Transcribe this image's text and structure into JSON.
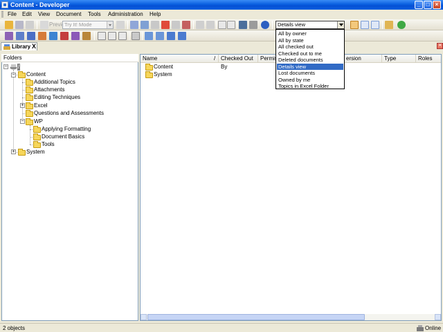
{
  "window": {
    "title": "Content - Developer"
  },
  "menu": [
    "File",
    "Edit",
    "View",
    "Document",
    "Tools",
    "Administration",
    "Help"
  ],
  "toolbar": {
    "preview_label": "Preview",
    "mode_value": "Try It! Mode"
  },
  "view_selector": {
    "value": "Details view",
    "options": [
      "All by owner",
      "All by state",
      "All checked out",
      "Checked out to me",
      "Deleted documents",
      "Details view",
      "Lost documents",
      "Owned by me",
      "Topics in Excel Folder"
    ],
    "selected_index": 5
  },
  "library_tab": {
    "label": "Library",
    "close": "X"
  },
  "folders": {
    "header": "Folders",
    "root": "/",
    "items": [
      "Content",
      "Additional Topics",
      "Attachments",
      "Editing Techniques",
      "Excel",
      "Questions and Assessments",
      "WP",
      "Applying Formatting",
      "Document Basics",
      "Tools",
      "System"
    ]
  },
  "list": {
    "columns": [
      "Name",
      "/",
      "Checked Out By",
      "Permissi",
      "ersion",
      "Type",
      "Roles"
    ],
    "rows": [
      "Content",
      "System"
    ]
  },
  "status": {
    "count": "2 objects",
    "connection": "Online"
  },
  "colors": {
    "titlebar": "#0a5fe0",
    "folder": "#f6d65b",
    "selection": "#316ac5"
  }
}
